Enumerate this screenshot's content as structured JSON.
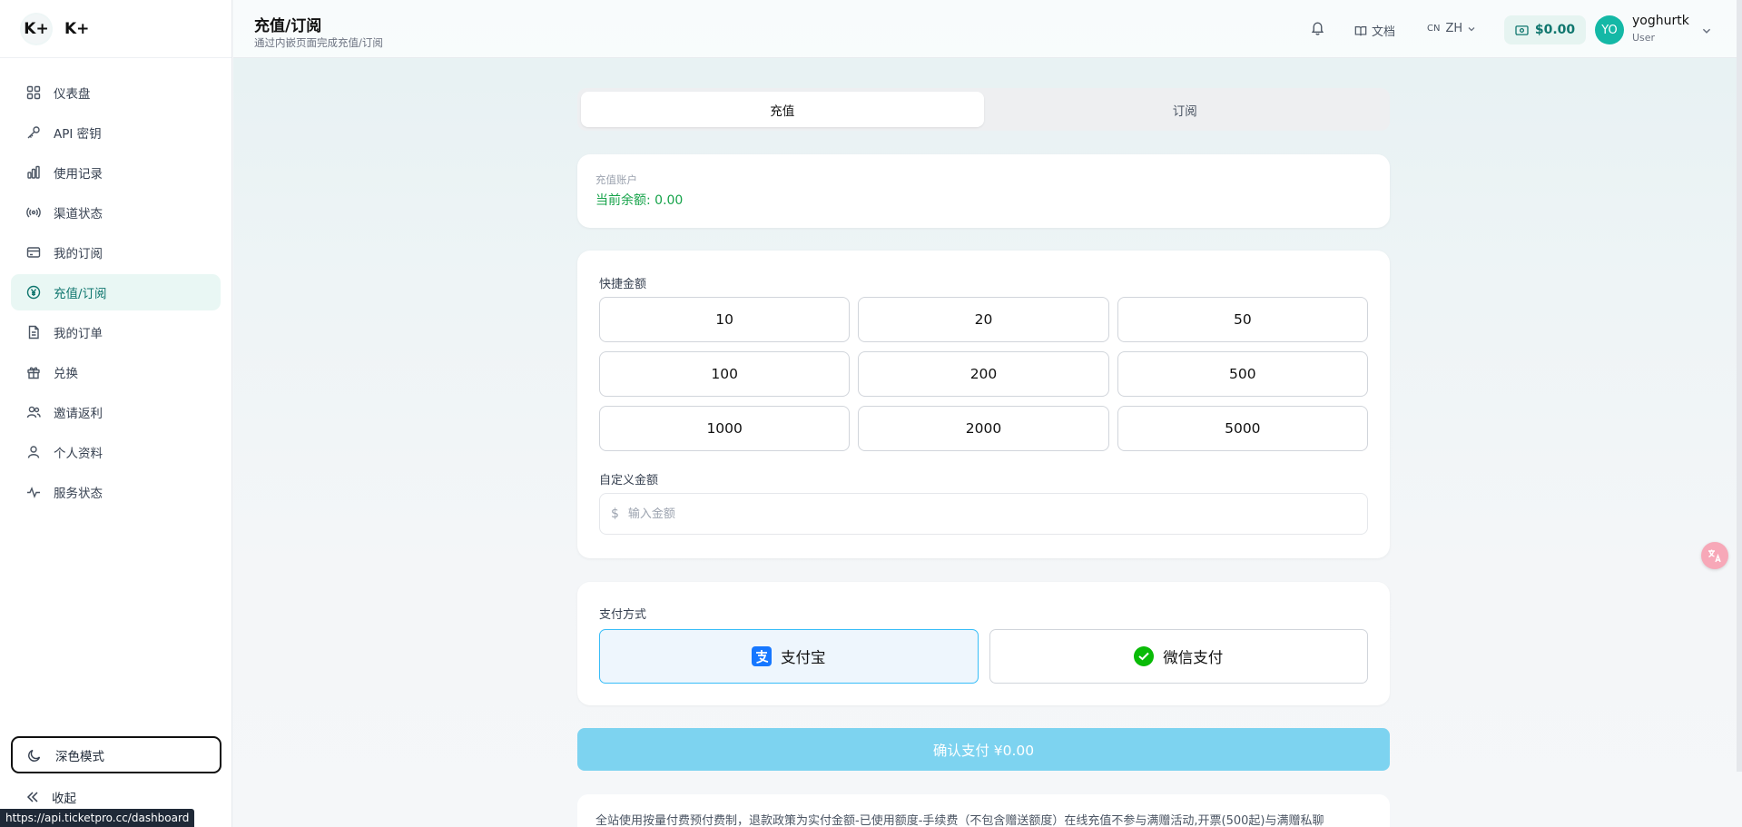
{
  "brand": {
    "logo": "K+",
    "name": "K+"
  },
  "sidebar": {
    "items": [
      {
        "label": "仪表盘",
        "icon": "grid-icon"
      },
      {
        "label": "API 密钥",
        "icon": "key-icon"
      },
      {
        "label": "使用记录",
        "icon": "bar-chart-icon"
      },
      {
        "label": "渠道状态",
        "icon": "broadcast-icon"
      },
      {
        "label": "我的订阅",
        "icon": "credit-card-icon"
      },
      {
        "label": "充值/订阅",
        "icon": "yuan-circle-icon",
        "active": true
      },
      {
        "label": "我的订单",
        "icon": "document-icon"
      },
      {
        "label": "兑换",
        "icon": "gift-icon"
      },
      {
        "label": "邀请返利",
        "icon": "users-icon"
      },
      {
        "label": "个人资料",
        "icon": "user-icon"
      },
      {
        "label": "服务状态",
        "icon": "activity-icon"
      }
    ],
    "dark_mode": "深色模式",
    "collapse": "收起"
  },
  "status_url": "https://api.ticketpro.cc/dashboard",
  "header": {
    "title": "充值/订阅",
    "subtitle": "通过内嵌页面完成充值/订阅",
    "docs": "文档",
    "lang_code": "CN",
    "lang": "ZH",
    "balance": "$0.00",
    "avatar": "YO",
    "username": "yoghurtk",
    "role": "User"
  },
  "tabs": [
    "充值",
    "订阅"
  ],
  "account": {
    "label": "充值账户",
    "balance": "当前余额: 0.00"
  },
  "quick": {
    "label": "快捷金额",
    "amounts": [
      "10",
      "20",
      "50",
      "100",
      "200",
      "500",
      "1000",
      "2000",
      "5000"
    ]
  },
  "custom": {
    "label": "自定义金额",
    "currency": "$",
    "placeholder": "输入金额"
  },
  "payment": {
    "label": "支付方式",
    "methods": [
      {
        "label": "支付宝",
        "icon": "alipay-icon",
        "color": "#1677ff",
        "selected": true
      },
      {
        "label": "微信支付",
        "icon": "wechat-icon",
        "color": "#09bb07",
        "selected": false
      }
    ]
  },
  "confirm": "确认支付 ¥0.00",
  "notice": "全站使用按量付费预付费制，退款政策为实付金额-已使用额度-手续费（不包含赠送额度）在线充值不参与满赠活动,开票(500起)与满赠私聊",
  "colors": {
    "accent": "#0f766e",
    "active_bg": "#e9f7f4",
    "confirm_bg": "#7dd3f0",
    "balance_green": "#16a34a"
  }
}
